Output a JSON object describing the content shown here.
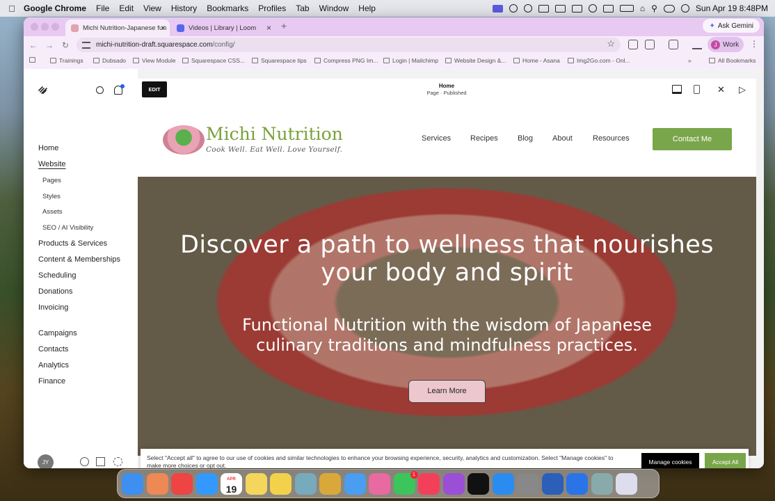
{
  "menubar": {
    "app": "Google Chrome",
    "items": [
      "File",
      "Edit",
      "View",
      "History",
      "Bookmarks",
      "Profiles",
      "Tab",
      "Window",
      "Help"
    ],
    "clock": "Sun Apr 19  8:48PM"
  },
  "browser": {
    "tabs": [
      {
        "title": "Michi Nutrition-Japanese fun",
        "color": "#e2a3b0"
      },
      {
        "title": "Videos | Library | Loom",
        "color": "#5566ee"
      }
    ],
    "new_tab": "+",
    "ask_gemini": "Ask Gemini",
    "url_host": "michi-nutrition-draft.squarespace.com",
    "url_path": "/config/",
    "profile": {
      "initial": "J",
      "label": "Work"
    },
    "bookmarks": [
      "Trainings",
      "Dubsado",
      "View Module",
      "Squarespace CSS...",
      "Squarespace tips",
      "Compress PNG Im...",
      "Login | Mailchimp",
      "Website Design &...",
      "Home - Asana",
      "Img2Go.com - Onl..."
    ],
    "all_bookmarks": "All Bookmarks"
  },
  "sidebar": {
    "nav": [
      {
        "label": "Home",
        "sub": false,
        "sel": false
      },
      {
        "label": "Website",
        "sub": false,
        "sel": true
      },
      {
        "label": "Pages",
        "sub": true
      },
      {
        "label": "Styles",
        "sub": true
      },
      {
        "label": "Assets",
        "sub": true
      },
      {
        "label": "SEO / AI Visibility",
        "sub": true
      },
      {
        "label": "Products & Services"
      },
      {
        "label": "Content & Memberships"
      },
      {
        "label": "Scheduling"
      },
      {
        "label": "Donations"
      },
      {
        "label": "Invoicing"
      },
      {
        "label": "Campaigns"
      },
      {
        "label": "Contacts"
      },
      {
        "label": "Analytics"
      },
      {
        "label": "Finance"
      }
    ],
    "avatar": "JY"
  },
  "editor": {
    "edit_label": "EDIT",
    "page_title": "Home",
    "page_status": "Page · Published"
  },
  "site": {
    "brand": "Michi Nutrition",
    "tagline": "Cook Well. Eat Well. Love Yourself.",
    "nav": [
      "Services",
      "Recipes",
      "Blog",
      "About",
      "Resources"
    ],
    "contact": "Contact Me",
    "hero_title": "Discover a path to wellness that nourishes your body and spirit",
    "hero_sub": "Functional Nutrition with the wisdom of Japanese culinary traditions and mindfulness practices.",
    "cta": "Learn More"
  },
  "cookie": {
    "text": "Select \"Accept all\" to agree to our use of cookies and similar technologies to enhance your browsing experience, security, analytics and customization. Select \"Manage cookies\" to make more choices or opt out.",
    "manage": "Manage cookies",
    "accept": "Accept All"
  },
  "dock": {
    "calendar_month": "APR",
    "calendar_day": "19",
    "messages_badge": "1",
    "apps": [
      {
        "name": "finder-icon",
        "color": "#3d8ff0"
      },
      {
        "name": "launchpad-icon",
        "color": "#e85"
      },
      {
        "name": "chrome-icon",
        "color": "#e44"
      },
      {
        "name": "safari-icon",
        "color": "#39f"
      },
      {
        "name": "calendar-icon",
        "color": "#fff"
      },
      {
        "name": "notes-icon",
        "color": "#f5d65c"
      },
      {
        "name": "stickies-icon",
        "color": "#f2d24a"
      },
      {
        "name": "preview-icon",
        "color": "#7ab"
      },
      {
        "name": "keynote-icon",
        "color": "#d9a83a"
      },
      {
        "name": "mail-icon",
        "color": "#4a9df0"
      },
      {
        "name": "photos-icon",
        "color": "#e86aa0"
      },
      {
        "name": "messages-icon",
        "color": "#3bc55a"
      },
      {
        "name": "music-icon",
        "color": "#f3405a"
      },
      {
        "name": "podcasts-icon",
        "color": "#9b4fd6"
      },
      {
        "name": "appletv-icon",
        "color": "#111"
      },
      {
        "name": "appstore-icon",
        "color": "#2a8cf0"
      },
      {
        "name": "settings-icon",
        "color": "#888"
      },
      {
        "name": "word-icon",
        "color": "#2b5fb8"
      },
      {
        "name": "gear-app-icon",
        "color": "#2b74e8"
      },
      {
        "name": "screen-app-icon",
        "color": "#8aa"
      },
      {
        "name": "trash-icon",
        "color": "#dde"
      }
    ]
  }
}
